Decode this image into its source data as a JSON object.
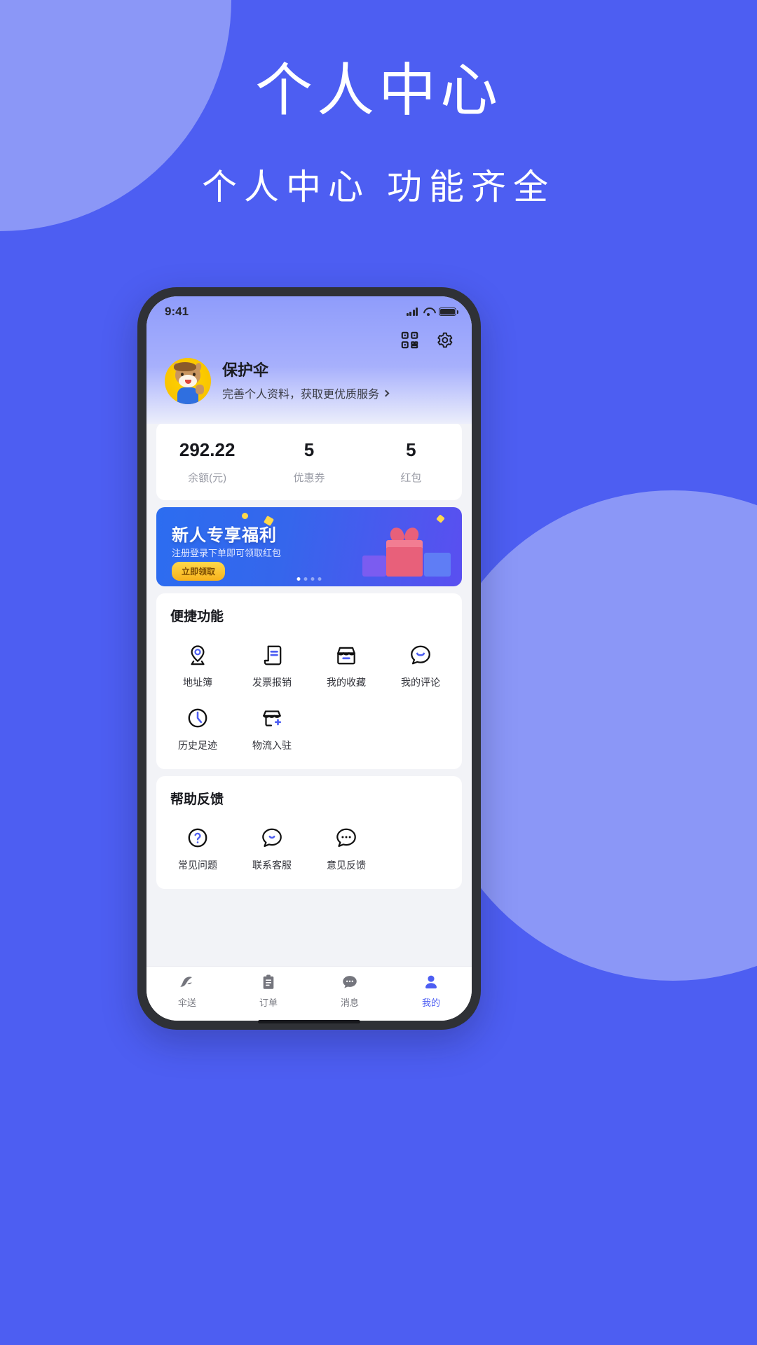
{
  "hero": {
    "title": "个人中心",
    "subtitle": "个人中心 功能齐全"
  },
  "colors": {
    "page_bg": "#4d5ef2",
    "blob": "#8b97f7",
    "accent": "#4d5ef2",
    "banner_start": "#2c6df0",
    "banner_end": "#5a4ff0",
    "cta": "#ffd84a"
  },
  "phone": {
    "statusbar": {
      "time": "9:41",
      "signal_icon": "signal-bars-icon",
      "wifi_icon": "wifi-icon",
      "battery_icon": "battery-icon"
    },
    "header": {
      "qr_icon": "qr-code-icon",
      "settings_icon": "gear-icon"
    },
    "profile": {
      "avatar_icon": "horse-mascot-avatar",
      "name": "保护伞",
      "description": "完善个人资料，获取更优质服务",
      "chevron_icon": "chevron-right-icon"
    },
    "stats": [
      {
        "value": "292.22",
        "label": "余额(元)"
      },
      {
        "value": "5",
        "label": "优惠券"
      },
      {
        "value": "5",
        "label": "红包"
      }
    ],
    "banner": {
      "title": "新人专享福利",
      "subtitle": "注册登录下单即可领取红包",
      "cta": "立即领取",
      "dots_total": 4,
      "dots_active_index": 0
    },
    "sections": [
      {
        "title": "便捷功能",
        "items": [
          {
            "label": "地址簿",
            "icon": "location-pin-icon"
          },
          {
            "label": "发票报销",
            "icon": "invoice-icon"
          },
          {
            "label": "我的收藏",
            "icon": "shop-icon"
          },
          {
            "label": "我的评论",
            "icon": "comment-icon"
          },
          {
            "label": "历史足迹",
            "icon": "clock-icon"
          },
          {
            "label": "物流入驻",
            "icon": "shop-add-icon"
          }
        ]
      },
      {
        "title": "帮助反馈",
        "items": [
          {
            "label": "常见问题",
            "icon": "question-circle-icon"
          },
          {
            "label": "联系客服",
            "icon": "headset-chat-icon"
          },
          {
            "label": "意见反馈",
            "icon": "feedback-bubble-icon"
          }
        ]
      }
    ],
    "tabbar": [
      {
        "label": "伞送",
        "icon": "umbrella-delivery-icon",
        "active": false
      },
      {
        "label": "订单",
        "icon": "order-clipboard-icon",
        "active": false
      },
      {
        "label": "消息",
        "icon": "message-bubble-icon",
        "active": false
      },
      {
        "label": "我的",
        "icon": "person-icon",
        "active": true
      }
    ]
  }
}
